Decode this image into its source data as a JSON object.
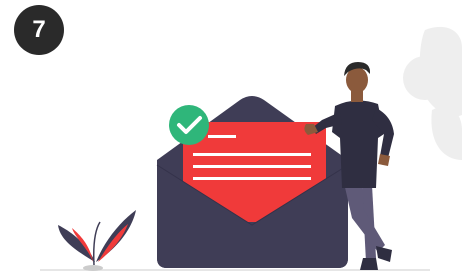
{
  "step": {
    "number": "7"
  },
  "illustration": {
    "description_icons": [
      "open-envelope-icon",
      "letter-icon",
      "check-circle-icon",
      "person-icon",
      "plant-icon"
    ],
    "colors": {
      "envelope": "#3f3d56",
      "letter": "#f03a3a",
      "letter_lines": "#ffffff",
      "check_circle": "#2fb67a",
      "skin": "#8b5a3c",
      "hair": "#2a2a2a",
      "shirt": "#2f2e41",
      "pants": "#5f5a78",
      "background_shape": "#eeeeee",
      "plant_dark": "#3f3d56",
      "plant_red": "#f03a3a",
      "ground": "#cccccc"
    }
  }
}
